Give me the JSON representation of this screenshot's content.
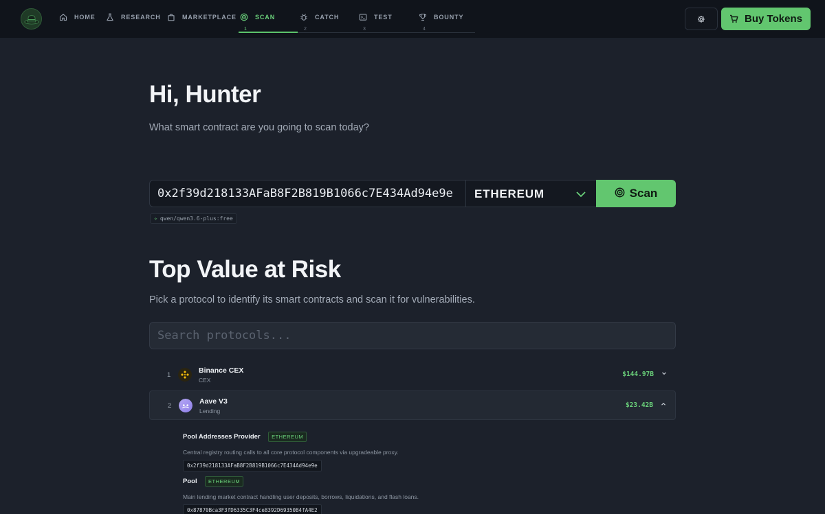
{
  "nav": {
    "items": [
      {
        "label": "HOME",
        "num": "",
        "icon": "home-icon"
      },
      {
        "label": "RESEARCH",
        "num": "",
        "icon": "flask-icon"
      },
      {
        "label": "MARKETPLACE",
        "num": "",
        "icon": "shopping-bag-icon"
      },
      {
        "label": "SCAN",
        "num": "1",
        "icon": "radar-icon",
        "active": true
      },
      {
        "label": "CATCH",
        "num": "2",
        "icon": "bug-icon"
      },
      {
        "label": "TEST",
        "num": "3",
        "icon": "terminal-icon"
      },
      {
        "label": "BOUNTY",
        "num": "4",
        "icon": "trophy-icon"
      }
    ],
    "buy_label": "Buy Tokens"
  },
  "hero": {
    "greeting": "Hi, Hunter",
    "subtitle": "What smart contract are you going to scan today?"
  },
  "scan": {
    "address_value": "0x2f39d218133AFaB8F2B819B1066c7E434Ad94e9e",
    "chain_value": "ETHEREUM",
    "scan_label": "Scan",
    "model_badge": "qwen/qwen3.6-plus:free"
  },
  "risk": {
    "title": "Top Value at Risk",
    "subtitle": "Pick a protocol to identify its smart contracts and scan it for vulnerabilities.",
    "search_placeholder": "Search protocols...",
    "protocols": [
      {
        "rank": "1",
        "name": "Binance CEX",
        "category": "CEX",
        "value": "$144.97B",
        "expanded": false
      },
      {
        "rank": "2",
        "name": "Aave V3",
        "category": "Lending",
        "value": "$23.42B",
        "expanded": true
      }
    ],
    "contracts": [
      {
        "name": "Pool Addresses Provider",
        "chain": "ETHEREUM",
        "description": "Central registry routing calls to all core protocol components via upgradeable proxy.",
        "address": "0x2f39d218133AFaB8F2B819B1066c7E434Ad94e9e"
      },
      {
        "name": "Pool",
        "chain": "ETHEREUM",
        "description": "Main lending market contract handling user deposits, borrows, liquidations, and flash loans.",
        "address": "0x87870Bca3F3fD6335C3F4ce8392D69350B4fA4E2"
      }
    ]
  },
  "colors": {
    "accent": "#62c66f",
    "background": "#1c212b",
    "topbar": "#10141b"
  }
}
